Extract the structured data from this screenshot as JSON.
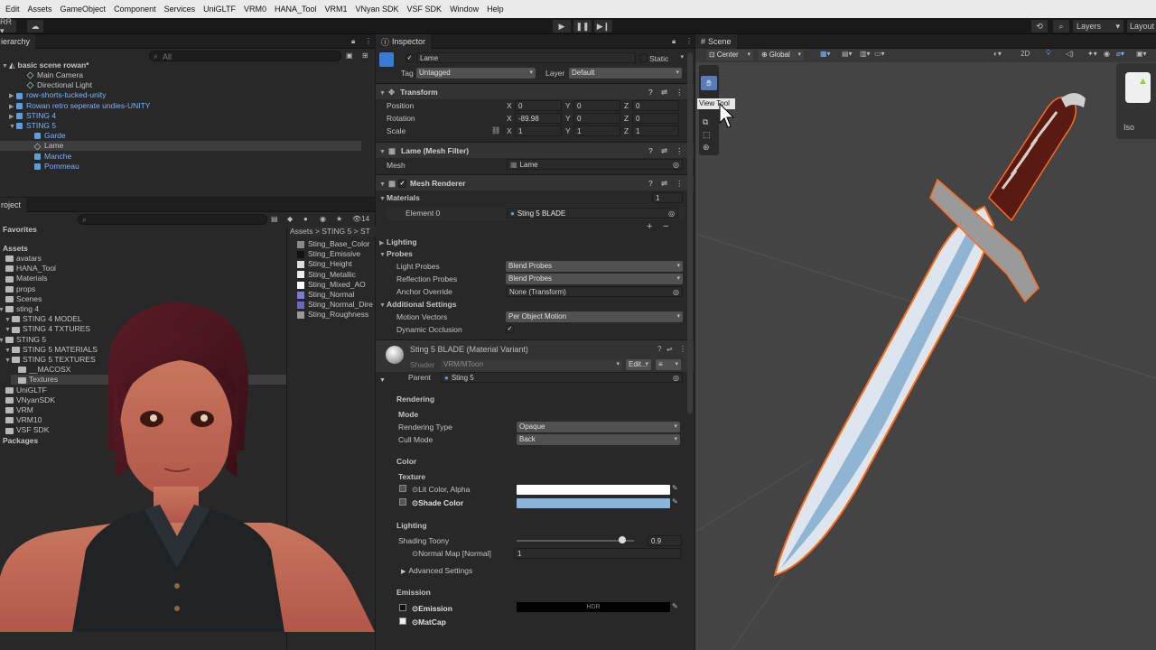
{
  "menu": [
    "Edit",
    "Assets",
    "GameObject",
    "Component",
    "Services",
    "UniGLTF",
    "VRM0",
    "HANA_Tool",
    "VRM1",
    "VNyan SDK",
    "VSF SDK",
    "Window",
    "Help"
  ],
  "toolbar": {
    "account": "RR ▾",
    "layers": "Layers",
    "layout": "Layout"
  },
  "hierarchy": {
    "tab": "ierarchy",
    "search_placeholder": "All",
    "scene": "basic scene rowan*",
    "items": [
      {
        "label": "Main Camera",
        "depth": 2,
        "blue": false
      },
      {
        "label": "Directional Light",
        "depth": 2,
        "blue": false
      },
      {
        "label": "row-shorts-tucked-unity",
        "depth": 1,
        "blue": true
      },
      {
        "label": "Rowan retro seperate undies-UNITY",
        "depth": 1,
        "blue": true
      },
      {
        "label": "STING 4",
        "depth": 1,
        "blue": true
      },
      {
        "label": "STING 5",
        "depth": 1,
        "blue": true
      },
      {
        "label": "Garde",
        "depth": 2,
        "blue": true
      },
      {
        "label": "Lame",
        "depth": 2,
        "blue": false
      },
      {
        "label": "Manche",
        "depth": 2,
        "blue": true
      },
      {
        "label": "Pommeau",
        "depth": 2,
        "blue": true
      }
    ]
  },
  "project": {
    "tab": "roject",
    "count": "14",
    "favorites": "Favorites",
    "assets": "Assets",
    "breadcrumb": "Assets > STING 5 > ST",
    "tree": [
      "avatars",
      "HANA_Tool",
      "Materials",
      "props",
      "Scenes",
      "sting 4",
      "STING 4 MODEL",
      "STING 4 TXTURES",
      "STING 5",
      "STING 5 MATERIALS",
      "STING 5 TEXTURES",
      "__MACOSX",
      "Textures",
      "UniGLTF",
      "VNyanSDK",
      "VRM",
      "VRM10",
      "VSF SDK",
      "Packages"
    ],
    "files": [
      "Sting_Base_Color",
      "Sting_Emissive",
      "Sting_Height",
      "Sting_Metallic",
      "Sting_Mixed_AO",
      "Sting_Normal",
      "Sting_Normal_Dire",
      "Sting_Roughness"
    ]
  },
  "inspector": {
    "tab": "Inspector",
    "name": "Lame",
    "static": "Static",
    "tag_label": "Tag",
    "tag": "Untagged",
    "layer_label": "Layer",
    "layer": "Default",
    "transform": {
      "title": "Transform",
      "position": "Position",
      "rotation": "Rotation",
      "scale": "Scale",
      "pos": [
        "0",
        "0",
        "0"
      ],
      "rot": [
        "-89.98",
        "0",
        "0"
      ],
      "scl": [
        "1",
        "1",
        "1"
      ]
    },
    "mesh_filter": {
      "title": "Lame (Mesh Filter)",
      "mesh_label": "Mesh",
      "mesh": "Lame"
    },
    "mesh_renderer": {
      "title": "Mesh Renderer",
      "materials": "Materials",
      "count": "1",
      "element": "Element 0",
      "material": "Sting 5 BLADE"
    },
    "lighting": "Lighting",
    "probes": "Probes",
    "light_probes": "Light Probes",
    "light_probes_val": "Blend Probes",
    "reflection_probes": "Reflection Probes",
    "reflection_probes_val": "Blend Probes",
    "anchor": "Anchor Override",
    "anchor_val": "None (Transform)",
    "additional": "Additional Settings",
    "motion": "Motion Vectors",
    "motion_val": "Per Object Motion",
    "occlusion": "Dynamic Occlusion",
    "material": {
      "title": "Sting 5 BLADE (Material Variant)",
      "shader_label": "Shader",
      "shader": "VRM/MToon",
      "edit": "Edit...",
      "parent_label": "Parent",
      "parent": "Sting 5"
    },
    "rendering": "Rendering",
    "mode": "Mode",
    "rendering_type": "Rendering Type",
    "rendering_type_val": "Opaque",
    "cull": "Cull Mode",
    "cull_val": "Back",
    "color": "Color",
    "texture": "Texture",
    "lit": "Lit Color, Alpha",
    "shade": "Shade Color",
    "lit_color": "#ffffff",
    "shade_color": "#8ab4d8",
    "lighting2": "Lighting",
    "toony": "Shading Toony",
    "toony_val": "0.9",
    "toony_level": 0.9,
    "normal": "Normal Map [Normal]",
    "normal_val": "1",
    "advanced": "Advanced Settings",
    "emission": "Emission",
    "emission_lbl": "Emission",
    "hdr": "HDR",
    "matcap": "MatCap"
  },
  "scene": {
    "tab": "Scene",
    "pivot": "Center",
    "space": "Global",
    "mode2d": "2D",
    "tooltip": "View Tool",
    "iso": "Iso"
  }
}
